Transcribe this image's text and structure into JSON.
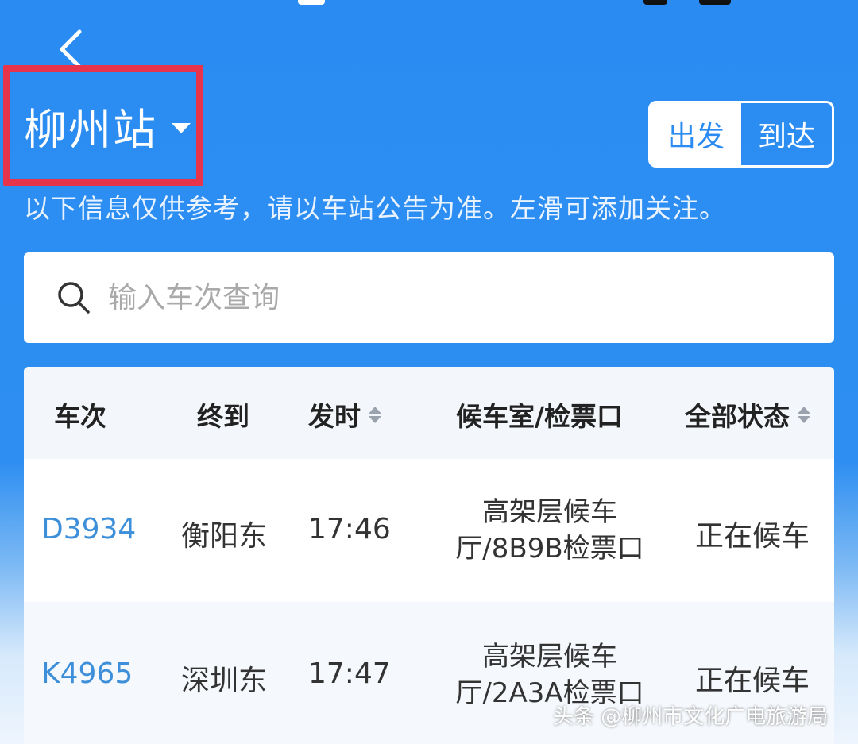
{
  "header": {
    "station": "柳州站",
    "segment": {
      "depart": "出发",
      "arrive": "到达",
      "active": "arrive"
    },
    "notice": "以下信息仅供参考，请以车站公告为准。左滑可添加关注。"
  },
  "search": {
    "placeholder": "输入车次查询"
  },
  "table": {
    "headers": {
      "train": "车次",
      "terminal": "终到",
      "time": "发时",
      "hall": "候车室/检票口",
      "status": "全部状态"
    },
    "rows": [
      {
        "train": "D3934",
        "terminal": "衡阳东",
        "time": "17:46",
        "hall_line1": "高架层候车",
        "hall_line2": "厅/8B9B检票口",
        "status": "正在候车"
      },
      {
        "train": "K4965",
        "terminal": "深圳东",
        "time": "17:47",
        "hall_line1": "高架层候车",
        "hall_line2": "厅/2A3A检票口",
        "status": "正在候车"
      }
    ]
  },
  "watermark": "头条 @柳州市文化广电旅游局",
  "colors": {
    "primary": "#2a8cf2",
    "highlight_border": "#e8344a",
    "train_link": "#3d8fd9"
  }
}
